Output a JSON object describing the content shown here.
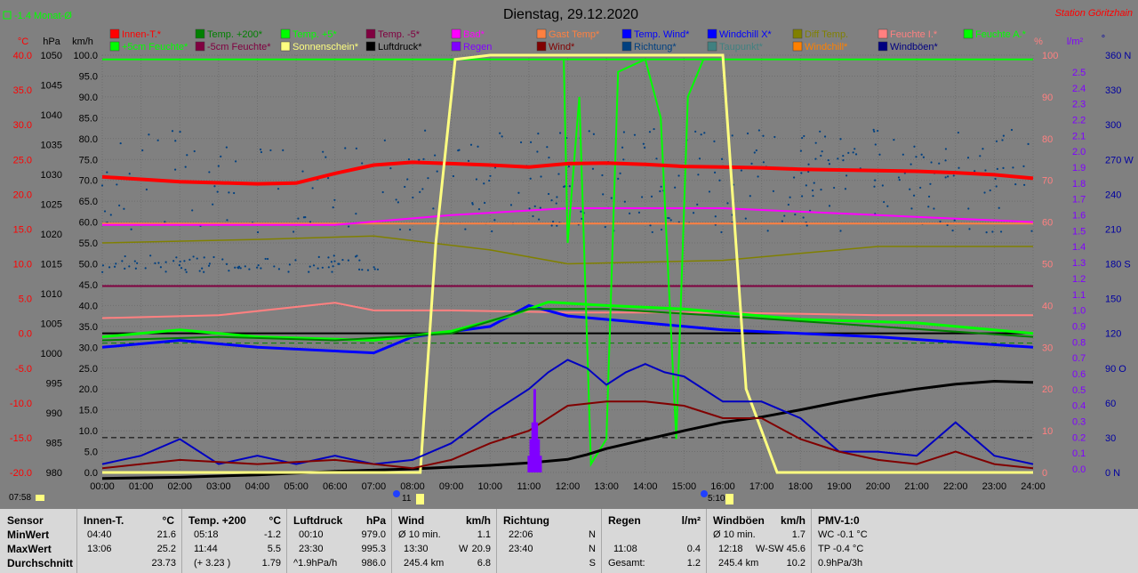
{
  "header": {
    "monat_text": "-1.4 Monat-Ø",
    "title": "Dienstag, 29.12.2020",
    "station": "Station Göritzhain"
  },
  "axes": {
    "units": {
      "celsius": "°C",
      "hpa": "hPa",
      "kmh": "km/h",
      "percent": "%",
      "lm2": "l/m²",
      "deg": "°"
    },
    "celsius": [
      "40.0",
      "35.0",
      "30.0",
      "25.0",
      "20.0",
      "15.0",
      "10.0",
      "5.0",
      "0.0",
      "-5.0",
      "-10.0",
      "-15.0",
      "-20.0"
    ],
    "hpa": [
      "1050",
      "1045",
      "1040",
      "1035",
      "1030",
      "1025",
      "1020",
      "1015",
      "1010",
      "1005",
      "1000",
      "995",
      "990",
      "985",
      "980"
    ],
    "kmh": [
      "100.0",
      "95.0",
      "90.0",
      "85.0",
      "80.0",
      "75.0",
      "70.0",
      "65.0",
      "60.0",
      "55.0",
      "50.0",
      "45.0",
      "40.0",
      "35.0",
      "30.0",
      "25.0",
      "20.0",
      "15.0",
      "10.0",
      "5.0",
      "0.0"
    ],
    "percent": [
      "100",
      "90",
      "80",
      "70",
      "60",
      "50",
      "40",
      "30",
      "20",
      "10",
      "0"
    ],
    "lm2": [
      "2.5",
      "2.4",
      "2.3",
      "2.2",
      "2.1",
      "2.0",
      "1.9",
      "1.8",
      "1.7",
      "1.6",
      "1.5",
      "1.4",
      "1.3",
      "1.2",
      "1.1",
      "1.0",
      "0.9",
      "0.8",
      "0.7",
      "0.6",
      "0.5",
      "0.4",
      "0.3",
      "0.2",
      "0.1",
      "0.0"
    ],
    "deg": [
      "360 N",
      "330",
      "300",
      "270 W",
      "240",
      "210",
      "180 S",
      "150",
      "120",
      "90 O",
      "60",
      "30",
      "0 N"
    ],
    "time": [
      "00:00",
      "01:00",
      "02:00",
      "03:00",
      "04:00",
      "05:00",
      "06:00",
      "07:00",
      "08:00",
      "09:00",
      "10:00",
      "11:00",
      "12:00",
      "13:00",
      "14:00",
      "15:00",
      "16:00",
      "17:00",
      "18:00",
      "19:00",
      "20:00",
      "21:00",
      "22:00",
      "23:00",
      "24:00"
    ]
  },
  "footer_times": {
    "sunrise": "07:58",
    "moon_a": "11",
    "moon_b": "5:10"
  },
  "legend": [
    {
      "label": "Innen-T.*",
      "color": "#ff0000"
    },
    {
      "label": "Temp. +200*",
      "color": "#008000"
    },
    {
      "label": "Temp. +5*",
      "color": "#00ff00"
    },
    {
      "label": "Temp. -5*",
      "color": "#800040"
    },
    {
      "label": "Bad*",
      "color": "#ff00ff"
    },
    {
      "label": "Gast Temp*",
      "color": "#ff8040"
    },
    {
      "label": "Temp. Wind*",
      "color": "#0000ff"
    },
    {
      "label": "Windchill X*",
      "color": "#0000ff"
    },
    {
      "label": "Diff Temp.",
      "color": "#808000"
    },
    {
      "label": "Feuchte I.*",
      "color": "#ff8080"
    },
    {
      "label": "Feuchte A.*",
      "color": "#00ff00"
    },
    {
      "label": "+5cm Feuchte*",
      "color": "#00ff00"
    },
    {
      "label": "-5cm Feuchte*",
      "color": "#800040"
    },
    {
      "label": "Sonnenschein*",
      "color": "#ffff80"
    },
    {
      "label": "Luftdruck*",
      "color": "#000000"
    },
    {
      "label": "Regen",
      "color": "#8000ff"
    },
    {
      "label": "Wind*",
      "color": "#800000"
    },
    {
      "label": "Richtung*",
      "color": "#004080"
    },
    {
      "label": "Taupunkt*",
      "color": "#408080"
    },
    {
      "label": "Windchill*",
      "color": "#ff8000"
    },
    {
      "label": "Windböen*",
      "color": "#000080"
    }
  ],
  "chart_data": {
    "type": "line",
    "title": "Dienstag, 29.12.2020",
    "x_unit": "hour of day",
    "x_range": [
      0,
      24
    ],
    "series": [
      {
        "name": "Innen-T.*",
        "axis": "°C",
        "x": [
          0,
          2,
          4,
          5,
          6,
          7,
          8,
          9,
          10,
          11,
          12,
          13,
          14,
          15,
          16,
          17,
          18,
          19,
          20,
          21,
          22,
          23,
          24
        ],
        "y": [
          22.5,
          21.8,
          21.5,
          21.6,
          23.0,
          24.2,
          24.6,
          24.4,
          24.2,
          23.9,
          24.4,
          24.5,
          24.3,
          24.0,
          23.9,
          23.8,
          23.6,
          23.5,
          23.4,
          23.3,
          23.1,
          22.8,
          22.3
        ]
      },
      {
        "name": "Luftdruck*",
        "axis": "hPa",
        "x": [
          0,
          2,
          4,
          6,
          8,
          10,
          11,
          12,
          12.5,
          13,
          14,
          15,
          16,
          17,
          18,
          19,
          20,
          21,
          22,
          23,
          24
        ],
        "y": [
          979.0,
          979.2,
          979.6,
          980.2,
          980.6,
          981.2,
          981.6,
          982.2,
          983.0,
          984.0,
          985.5,
          987.0,
          988.4,
          989.3,
          990.5,
          991.8,
          993.0,
          994.0,
          994.8,
          995.3,
          995.1
        ]
      },
      {
        "name": "Sonnenschein*",
        "axis": "%",
        "x": [
          0,
          8.2,
          8.6,
          9.1,
          10,
          15,
          16,
          16.3,
          16.6,
          17.4,
          24
        ],
        "y": [
          0,
          0,
          55,
          99,
          100,
          100,
          100,
          60,
          20,
          0,
          0
        ]
      },
      {
        "name": "Windböen*",
        "axis": "km/h",
        "x": [
          0,
          1,
          2,
          3,
          4,
          5,
          6,
          7,
          8,
          9,
          10,
          11,
          11.5,
          12,
          12.5,
          13,
          13.5,
          14,
          14.5,
          15,
          16,
          17,
          18,
          19,
          20,
          21,
          22,
          23,
          24
        ],
        "y": [
          2,
          4,
          8,
          2,
          4,
          2,
          4,
          2,
          3,
          7,
          14,
          20,
          24,
          27,
          25,
          21,
          24,
          26,
          24,
          23,
          17,
          17,
          13,
          5,
          5,
          4,
          12,
          4,
          2
        ]
      },
      {
        "name": "Wind*",
        "axis": "km/h",
        "x": [
          0,
          2,
          4,
          6,
          8,
          9,
          10,
          11,
          12,
          13,
          14,
          15,
          16,
          17,
          18,
          19,
          20,
          21,
          22,
          23,
          24
        ],
        "y": [
          1,
          3,
          2,
          3,
          1,
          3,
          7,
          10,
          16,
          17,
          17,
          16,
          13,
          13,
          8,
          5,
          3,
          2,
          5,
          2,
          1
        ]
      },
      {
        "name": "Regen",
        "axis": "l/m²",
        "x": [
          11.0,
          11.05,
          11.1,
          11.15,
          11.2,
          11.25,
          11.3
        ],
        "y": [
          0.1,
          0.2,
          0.3,
          0.5,
          0.3,
          0.2,
          0.1
        ]
      }
    ]
  },
  "stats": {
    "col_sensor": {
      "header": "Sensor",
      "r1": "MinWert",
      "r2": "MaxWert",
      "r3": "Durchschnitt"
    },
    "col_innen": {
      "header": "Innen-T.",
      "unit": "°C",
      "r1_time": "04:40",
      "r1_val": "21.6",
      "r2_time": "13:06",
      "r2_val": "25.2",
      "r3_val": "23.73"
    },
    "col_temp": {
      "header": "Temp. +200",
      "unit": "°C",
      "r1_time": "05:18",
      "r1_val": "-1.2",
      "r2_time": "11:44",
      "r2_val": "5.5",
      "r3_time": "(+ 3.23 )",
      "r3_val": "1.79"
    },
    "col_luft": {
      "header": "Luftdruck",
      "unit": "hPa",
      "r1_time": "00:10",
      "r1_val": "979.0",
      "r2_time": "23:30",
      "r2_val": "995.3",
      "r3_time": "^1.9hPa/h",
      "r3_val": "986.0"
    },
    "col_wind": {
      "header": "Wind",
      "unit": "km/h",
      "r1_time": "Ø 10 min.",
      "r1_val": "1.1",
      "r2_time": "13:30",
      "r2_mid": "W",
      "r2_val": "20.9",
      "r3_time": "245.4 km",
      "r3_val": "6.8"
    },
    "col_richtung": {
      "header": "Richtung",
      "r1_time": "22:06",
      "r1_val": "N",
      "r2_time": "23:40",
      "r2_val": "N",
      "r3_val": "S"
    },
    "col_regen": {
      "header": "Regen",
      "unit": "l/m²",
      "r2_time": "11:08",
      "r2_val": "0.4",
      "r3_time": "Gesamt:",
      "r3_val": "1.2"
    },
    "col_boen": {
      "header": "Windböen",
      "unit": "km/h",
      "r1_time": "Ø 10 min.",
      "r1_val": "1.7",
      "r2_time": "12:18",
      "r2_mid": "W-SW",
      "r2_val": "45.6",
      "r3_time": "245.4 km",
      "r3_val": "10.2"
    },
    "col_pmv": {
      "header": "PMV-1:0",
      "r1": "WC -0.1 °C",
      "r2": "TP -0.4 °C",
      "r3": "0.9hPa/3h"
    }
  }
}
